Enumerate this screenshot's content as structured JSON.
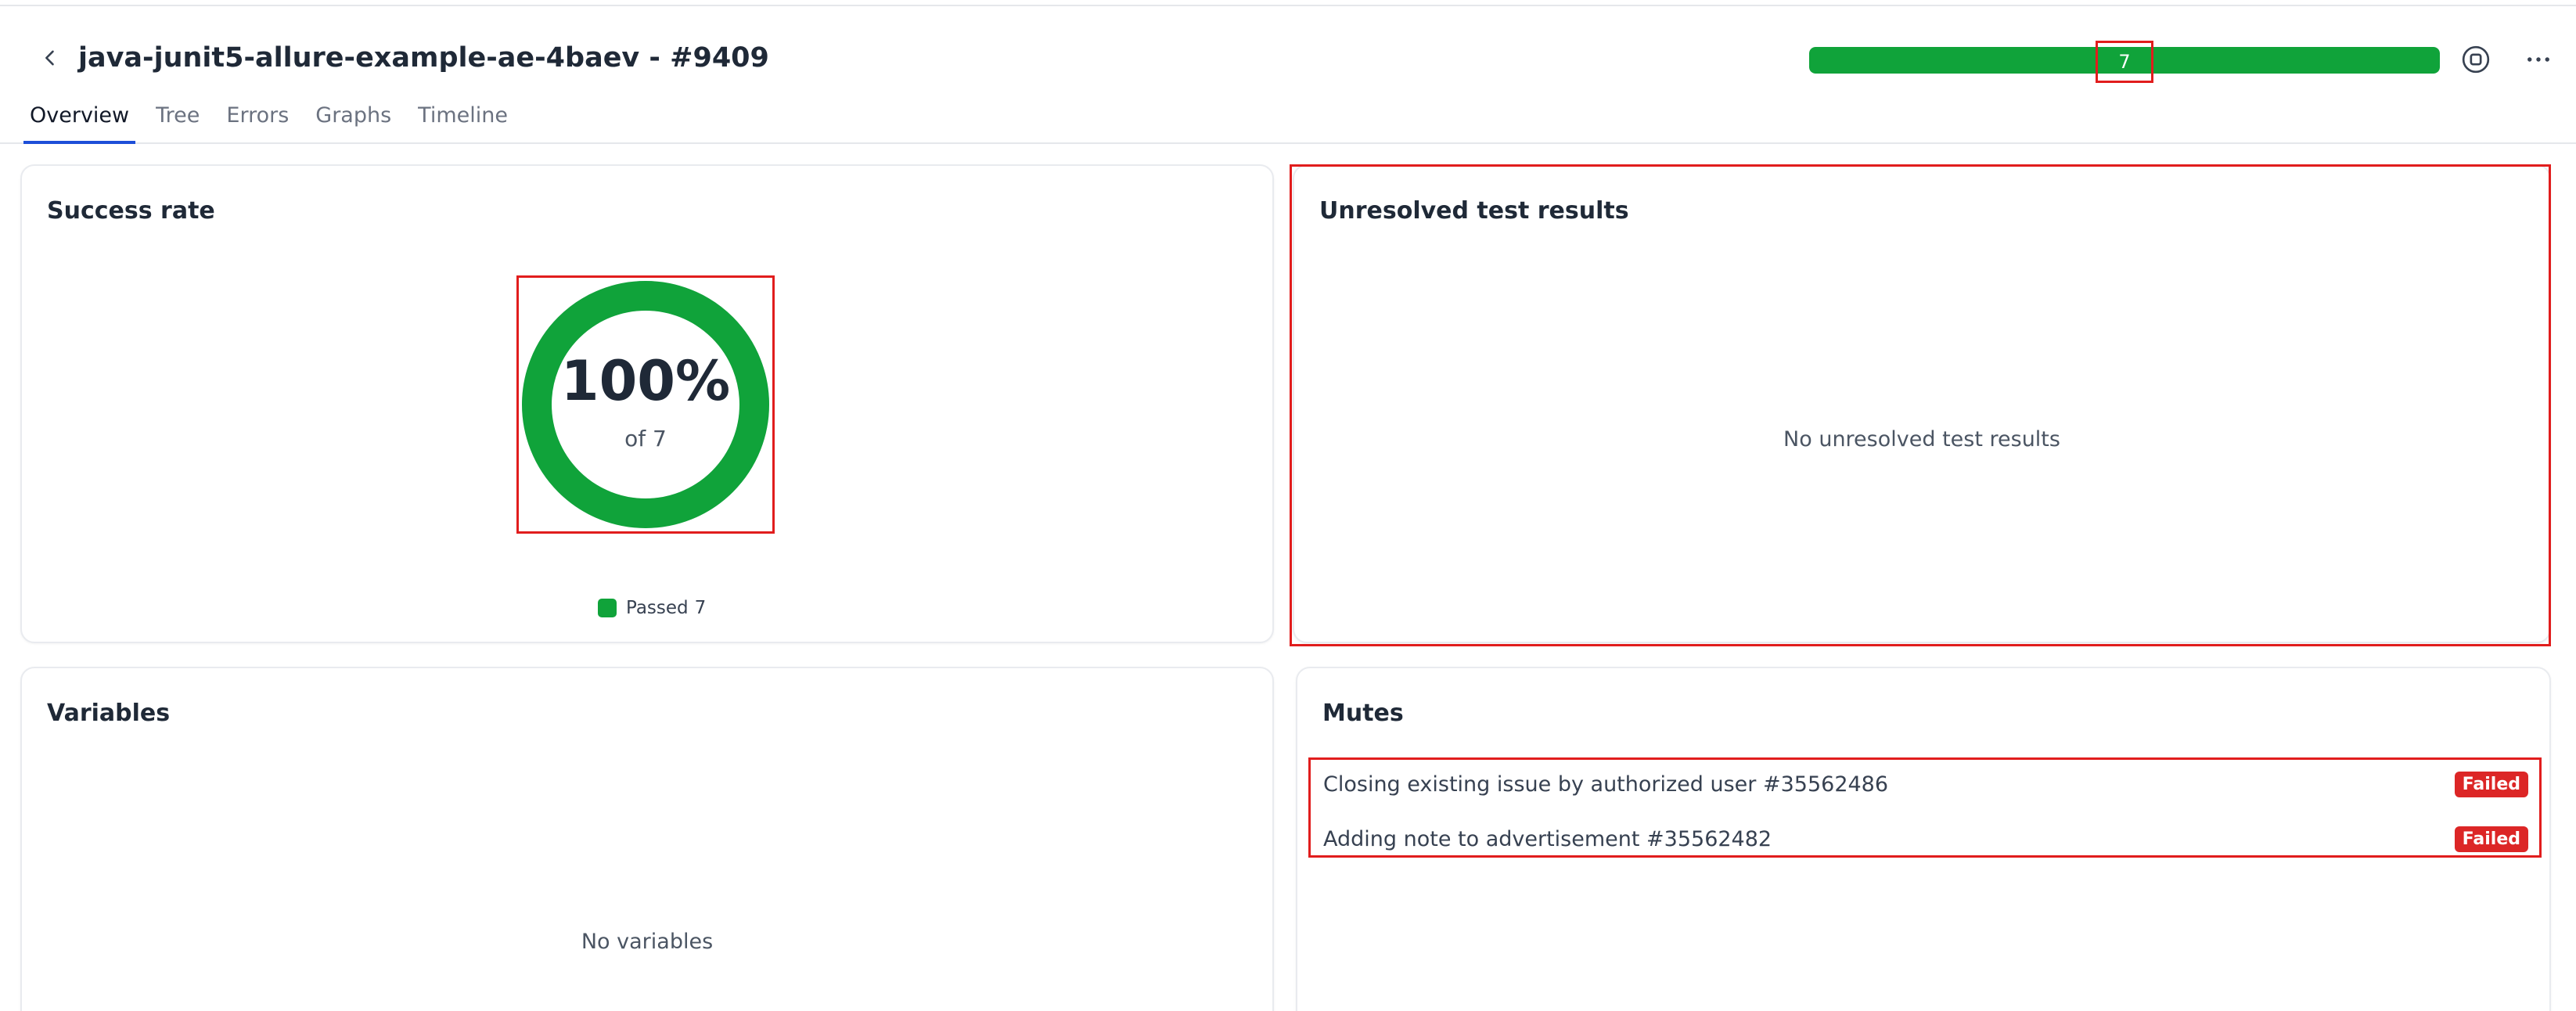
{
  "header": {
    "title": "java-junit5-allure-example-ae-4baev - #9409",
    "tabs": [
      {
        "label": "Overview",
        "active": true
      },
      {
        "label": "Tree",
        "active": false
      },
      {
        "label": "Errors",
        "active": false
      },
      {
        "label": "Graphs",
        "active": false
      },
      {
        "label": "Timeline",
        "active": false
      }
    ],
    "progress": {
      "count": "7",
      "passed_fraction": 1.0,
      "color": "#10a33a"
    },
    "icons": {
      "back": "chevron-left-icon",
      "stop": "stop-circle-icon",
      "more": "more-horizontal-icon"
    }
  },
  "success_rate": {
    "title": "Success rate",
    "percent_label": "100%",
    "of_label": "of 7",
    "fraction": 1.0,
    "legend": {
      "label": "Passed",
      "count": "7",
      "color": "#10a33a"
    }
  },
  "unresolved": {
    "title": "Unresolved test results",
    "empty_text": "No unresolved test results"
  },
  "variables": {
    "title": "Variables",
    "empty_text": "No variables"
  },
  "mutes": {
    "title": "Mutes",
    "items": [
      {
        "name": "Closing existing issue by authorized user #35562486",
        "status": "Failed"
      },
      {
        "name": "Adding note to advertisement #35562482",
        "status": "Failed"
      }
    ],
    "status_color": "#dc2626"
  }
}
